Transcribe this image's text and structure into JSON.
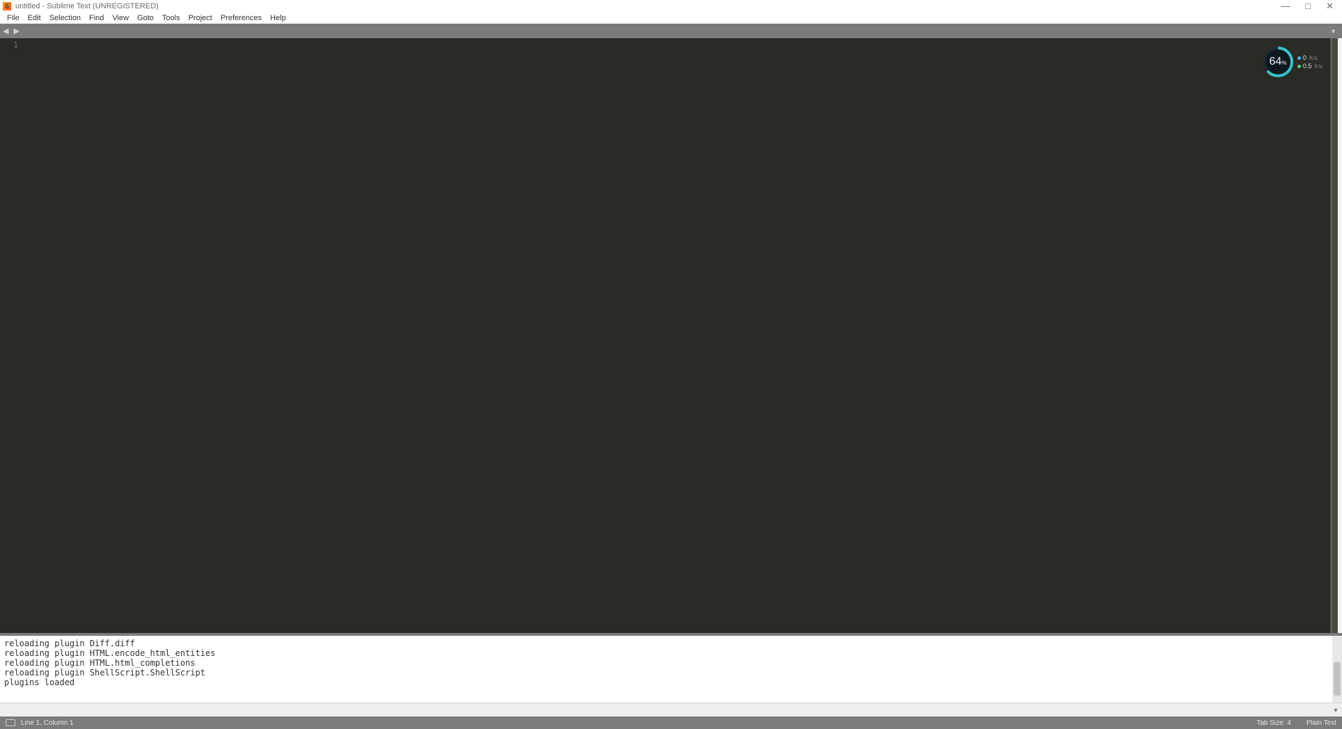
{
  "window": {
    "title": "untitled - Sublime Text (UNREGISTERED)"
  },
  "menus": [
    "File",
    "Edit",
    "Selection",
    "Find",
    "View",
    "Goto",
    "Tools",
    "Project",
    "Preferences",
    "Help"
  ],
  "editor": {
    "line_numbers": [
      "1"
    ]
  },
  "widget": {
    "percent": "64",
    "percent_unit": "%",
    "up_value": "0",
    "up_unit": "K/s",
    "down_value": "0.5",
    "down_unit": "K/s"
  },
  "console": {
    "lines": [
      "reloading plugin Diff.diff",
      "reloading plugin HTML.encode_html_entities",
      "reloading plugin HTML.html_completions",
      "reloading plugin ShellScript.ShellScript",
      "plugins loaded"
    ]
  },
  "status": {
    "cursor": "Line 1, Column 1",
    "tab_size": "Tab Size: 4",
    "syntax": "Plain Text"
  }
}
